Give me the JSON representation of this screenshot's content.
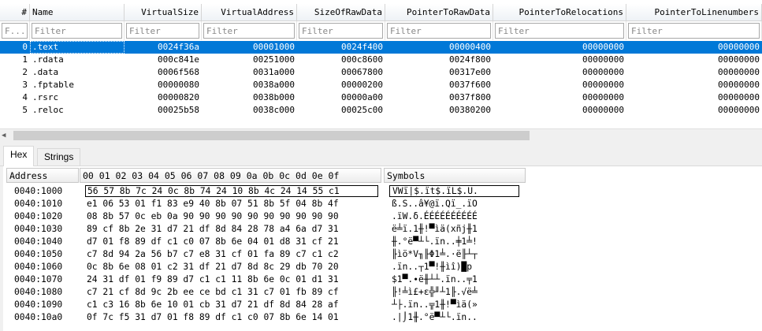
{
  "sections_table": {
    "columns": [
      {
        "label": "#",
        "filter": "F...",
        "width": 38,
        "align": "right"
      },
      {
        "label": "Name",
        "filter": "Filter",
        "width": 120,
        "align": "left"
      },
      {
        "label": "VirtualSize",
        "filter": "Filter",
        "width": 98,
        "align": "right"
      },
      {
        "label": "VirtualAddress",
        "filter": "Filter",
        "width": 121,
        "align": "right"
      },
      {
        "label": "SizeOfRawData",
        "filter": "Filter",
        "width": 112,
        "align": "right"
      },
      {
        "label": "PointerToRawData",
        "filter": "Filter",
        "width": 137,
        "align": "right"
      },
      {
        "label": "PointerToRelocations",
        "filter": "Filter",
        "width": 169,
        "align": "right"
      },
      {
        "label": "PointerToLinenumbers",
        "filter": "Filter",
        "width": 172,
        "align": "right"
      }
    ],
    "rows": [
      [
        "0",
        ".text",
        "0024f36a",
        "00001000",
        "0024f400",
        "00000400",
        "00000000",
        "00000000"
      ],
      [
        "1",
        ".rdata",
        "000c841e",
        "00251000",
        "000c8600",
        "0024f800",
        "00000000",
        "00000000"
      ],
      [
        "2",
        ".data",
        "0006f568",
        "0031a000",
        "00067800",
        "00317e00",
        "00000000",
        "00000000"
      ],
      [
        "3",
        ".fptable",
        "00000080",
        "0038a000",
        "00000200",
        "0037f600",
        "00000000",
        "00000000"
      ],
      [
        "4",
        ".rsrc",
        "00000820",
        "0038b000",
        "00000a00",
        "0037f800",
        "00000000",
        "00000000"
      ],
      [
        "5",
        ".reloc",
        "00025b58",
        "0038c000",
        "00025c00",
        "00380200",
        "00000000",
        "00000000"
      ]
    ],
    "selected_row": 0
  },
  "tabs": [
    {
      "label": "Hex",
      "active": true
    },
    {
      "label": "Strings",
      "active": false
    }
  ],
  "hex_view": {
    "address_header": "Address",
    "bytes_header": "00 01 02 03 04 05 06 07 08 09 0a 0b 0c 0d 0e 0f",
    "symbols_header": "Symbols",
    "rows": [
      {
        "addr": "0040:1000",
        "bytes": "56 57 8b 7c 24 0c 8b 74 24 10 8b 4c 24 14 55 c1",
        "syms": "VWï|$.ït$.ïL$.U."
      },
      {
        "addr": "0040:1010",
        "bytes": "e1 06 53 01 f1 83 e9 40 8b 07 51 8b 5f 04 8b 4f",
        "syms": "ß.S..â¥@ï.Qï_.ïO"
      },
      {
        "addr": "0040:1020",
        "bytes": "08 8b 57 0c eb 0a 90 90 90 90 90 90 90 90 90 90",
        "syms": ".ïW.δ.ÉÉÉÉÉÉÉÉÉÉ"
      },
      {
        "addr": "0040:1030",
        "bytes": "89 cf 8b 2e 31 d7 21 df 8d 84 28 78 a4 6a d7 31",
        "syms": "ë╧ï.1╫!▀ìä(xñj╫1"
      },
      {
        "addr": "0040:1040",
        "bytes": "d7 01 f8 89 df c1 c0 07 8b 6e 04 01 d8 31 cf 21",
        "syms": "╫.°ë▀┴└.ïn..╪1╧!"
      },
      {
        "addr": "0040:1050",
        "bytes": "c7 8d 94 2a 56 b7 c7 e8 31 cf 01 fa 89 c7 c1 c2",
        "syms": "╟ìö*V╖╟Φ1╧.·ë╟┴┬"
      },
      {
        "addr": "0040:1060",
        "bytes": "0c 8b 6e 08 01 c2 31 df 21 d7 8d 8c 29 db 70 20",
        "syms": ".ïn..┬1▀!╫ìî)█p "
      },
      {
        "addr": "0040:1070",
        "bytes": "24 31 df 01 f9 89 d7 c1 c1 11 8b 6e 0c 01 d1 31",
        "syms": "$1▀.∙ë╫┴┴.ïn..╤1"
      },
      {
        "addr": "0040:1080",
        "bytes": "c7 21 cf 8d 9c 2b ee ce bd c1 31 c7 01 fb 89 cf",
        "syms": "╟!╧ì£+ε╬╜┴1╟.√ë╧"
      },
      {
        "addr": "0040:1090",
        "bytes": "c1 c3 16 8b 6e 10 01 cb 31 d7 21 df 8d 84 28 af",
        "syms": "┴├.ïn..╦1╫!▀ìä(»"
      },
      {
        "addr": "0040:10a0",
        "bytes": "0f 7c f5 31 d7 01 f8 89 df c1 c0 07 8b 6e 14 01",
        "syms": ".|⌡1╫.°ë▀┴└.ïn.."
      }
    ]
  },
  "colors": {
    "selection": "#0078d7"
  }
}
